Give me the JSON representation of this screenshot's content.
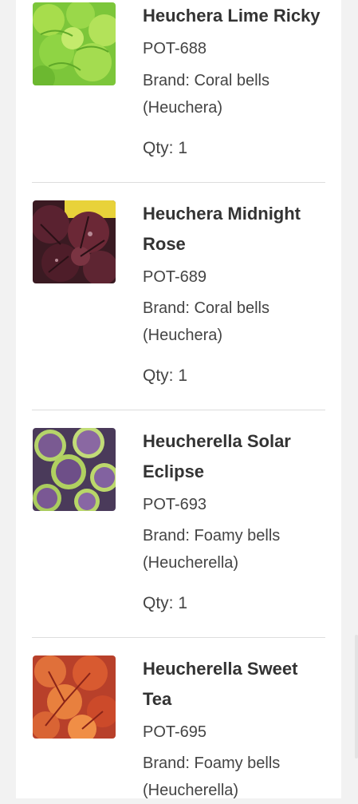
{
  "products": [
    {
      "name": "Heuchera Lime Ricky",
      "sku": "POT-688",
      "brand_line1": "Brand: Coral bells",
      "brand_line2": "(Heuchera)",
      "qty": "Qty: 1",
      "image_icon": "lime-green-foliage-image"
    },
    {
      "name_line1": "Heuchera Midnight",
      "name_line2": "Rose",
      "sku": "POT-689",
      "brand_line1": "Brand: Coral bells",
      "brand_line2": "(Heuchera)",
      "qty": "Qty: 1",
      "image_icon": "dark-purple-foliage-image"
    },
    {
      "name_line1": "Heucherella Solar",
      "name_line2": "Eclipse",
      "sku": "POT-693",
      "brand_line1": "Brand: Foamy bells",
      "brand_line2": "(Heucherella)",
      "qty": "Qty: 1",
      "image_icon": "purple-green-edged-foliage-image"
    },
    {
      "name_line1": "Heucherella Sweet",
      "name_line2": "Tea",
      "sku": "POT-695",
      "brand_line1": "Brand: Foamy bells",
      "brand_line2": "(Heucherella)",
      "image_icon": "orange-red-foliage-image"
    }
  ],
  "colors": {
    "background": "#f2f2f2",
    "card": "#ffffff",
    "divider": "#dddddd",
    "text": "#333333"
  }
}
